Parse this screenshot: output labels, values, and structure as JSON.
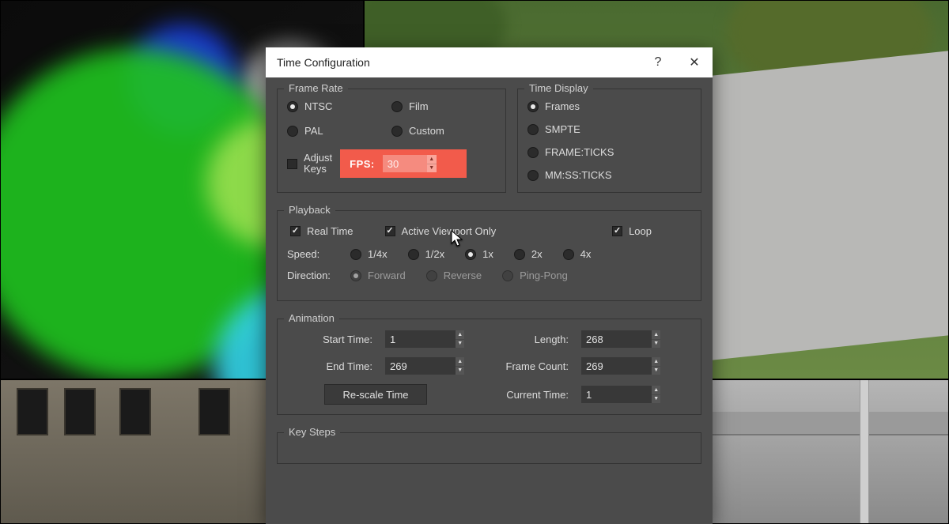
{
  "dialog": {
    "title": "Time Configuration"
  },
  "frameRate": {
    "legend": "Frame Rate",
    "options": {
      "ntsc": "NTSC",
      "film": "Film",
      "pal": "PAL",
      "custom": "Custom"
    },
    "selected": "ntsc",
    "adjustKeys": {
      "label": "Adjust\nKeys",
      "checked": false
    },
    "fpsLabel": "FPS:",
    "fpsValue": "30"
  },
  "timeDisplay": {
    "legend": "Time Display",
    "options": {
      "frames": "Frames",
      "smpte": "SMPTE",
      "frameTicks": "FRAME:TICKS",
      "mmssTicks": "MM:SS:TICKS"
    },
    "selected": "frames"
  },
  "playback": {
    "legend": "Playback",
    "realTime": {
      "label": "Real Time",
      "checked": true
    },
    "activeViewport": {
      "label": "Active Viewport Only",
      "checked": true
    },
    "loop": {
      "label": "Loop",
      "checked": true
    },
    "speedLabel": "Speed:",
    "speed": {
      "options": {
        "q": "1/4x",
        "h": "1/2x",
        "one": "1x",
        "two": "2x",
        "four": "4x"
      },
      "selected": "one"
    },
    "directionLabel": "Direction:",
    "direction": {
      "options": {
        "fwd": "Forward",
        "rev": "Reverse",
        "pp": "Ping-Pong"
      },
      "selected": "fwd",
      "disabled": true
    }
  },
  "animation": {
    "legend": "Animation",
    "labels": {
      "start": "Start Time:",
      "end": "End Time:",
      "length": "Length:",
      "count": "Frame Count:",
      "current": "Current Time:"
    },
    "values": {
      "start": "1",
      "end": "269",
      "length": "268",
      "count": "269",
      "current": "1"
    },
    "rescale": "Re-scale Time"
  },
  "keySteps": {
    "legend": "Key Steps"
  }
}
